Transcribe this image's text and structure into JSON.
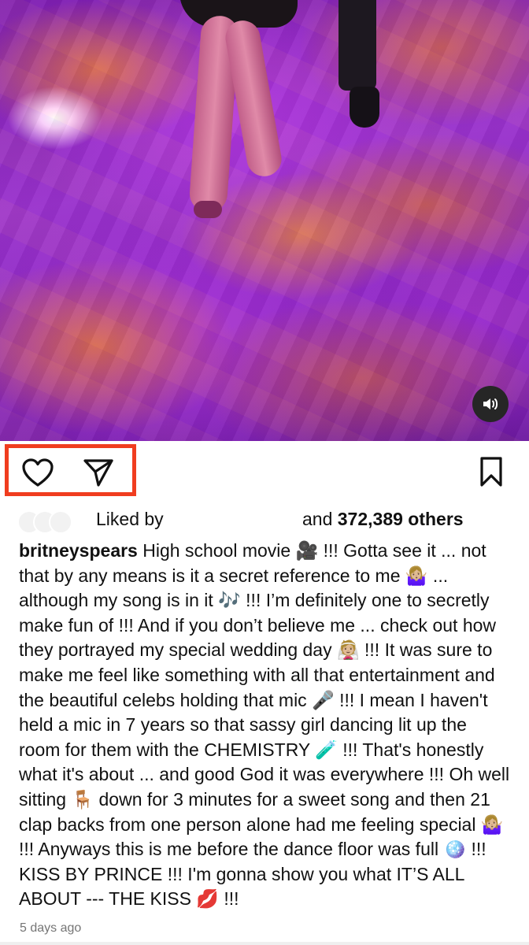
{
  "post": {
    "media_type": "video",
    "sound_icon": "speaker-icon"
  },
  "actions": {
    "like_icon": "heart-icon",
    "share_icon": "paper-plane-icon",
    "save_icon": "bookmark-icon",
    "highlight_color": "#f03d1f"
  },
  "likes": {
    "prefix": "Liked by",
    "and": "and",
    "count": "372,389 others"
  },
  "caption": {
    "username": "britneyspears",
    "text": "High school movie 🎥 !!! Gotta see it ... not that by any means is it a secret reference to me 🤷🏼‍♀️ ... although my song is in it 🎶 !!! I’m definitely one to secretly make fun of !!! And if you don’t believe me ... check out how they portrayed my special wedding day 👰🏼 !!! It was sure to make me feel like something with all that entertainment and the beautiful celebs holding that mic 🎤 !!!  I mean I haven't held a mic in 7 years so that sassy girl dancing lit up the room for them with the CHEMISTRY 🧪 !!! That's honestly what it's about ... and good God it was everywhere !!! Oh well sitting 🪑 down for 3 minutes for a sweet song and then 21 clap backs from one person alone had me feeling special 🤷🏼‍♀️ !!! Anyways this is me before the dance floor was full 🪩 !!! KISS BY PRINCE !!! I'm gonna show you what IT’S ALL ABOUT --- THE KISS 💋 !!!"
  },
  "timestamp": "5 days ago"
}
